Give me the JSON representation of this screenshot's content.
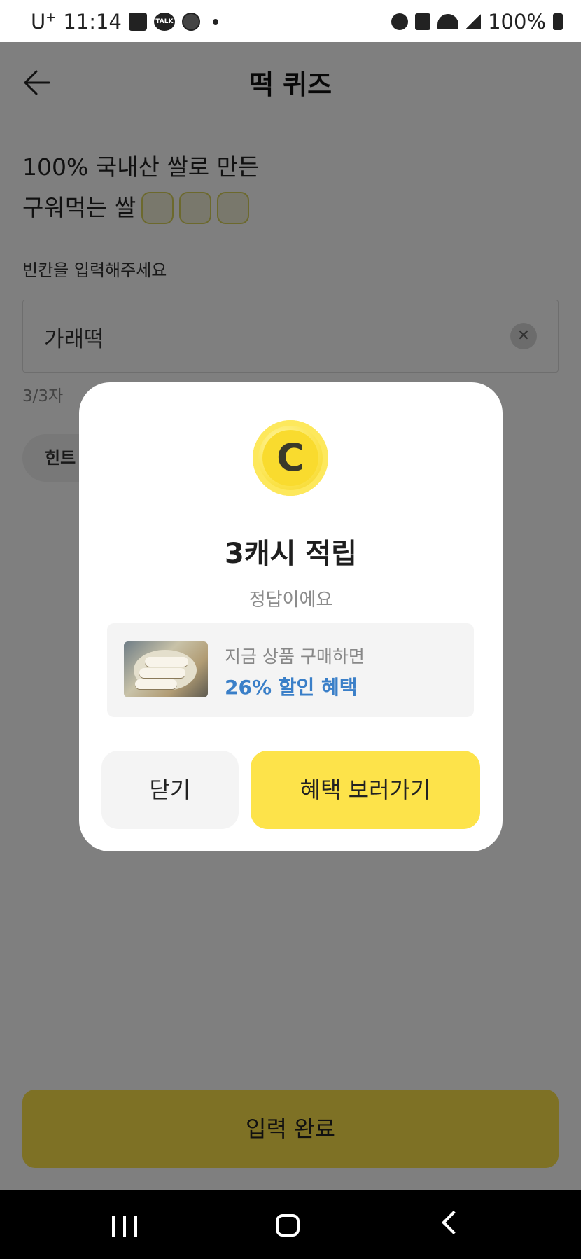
{
  "status_bar": {
    "carrier": "U",
    "carrier_sup": "+",
    "time": "11:14",
    "battery": "100%",
    "icons": [
      "gallery-icon",
      "kakaotalk-icon",
      "starbucks-icon",
      "alarm-icon",
      "mute-icon",
      "wifi-icon",
      "signal-icon",
      "battery-icon"
    ]
  },
  "header": {
    "title": "떡 퀴즈"
  },
  "question": {
    "line1": "100% 국내산 쌀로 만든",
    "line2": "구워먹는 쌀",
    "blank_count": 3
  },
  "input": {
    "label": "빈칸을 입력해주세요",
    "value": "가래떡",
    "count": "3/3자"
  },
  "hint": {
    "label": "힌트"
  },
  "submit": {
    "label": "입력 완료"
  },
  "modal": {
    "coin_letter": "C",
    "title": "3캐시 적립",
    "subtitle": "정답이에요",
    "promo": {
      "line1": "지금 상품 구매하면",
      "line2": "26% 할인 혜택"
    },
    "close_label": "닫기",
    "benefit_label": "혜택 보러가기"
  },
  "colors": {
    "accent_yellow": "#fde34a",
    "discount_blue": "#3a7fc8",
    "subtitle_gray": "#8c8c8c"
  }
}
